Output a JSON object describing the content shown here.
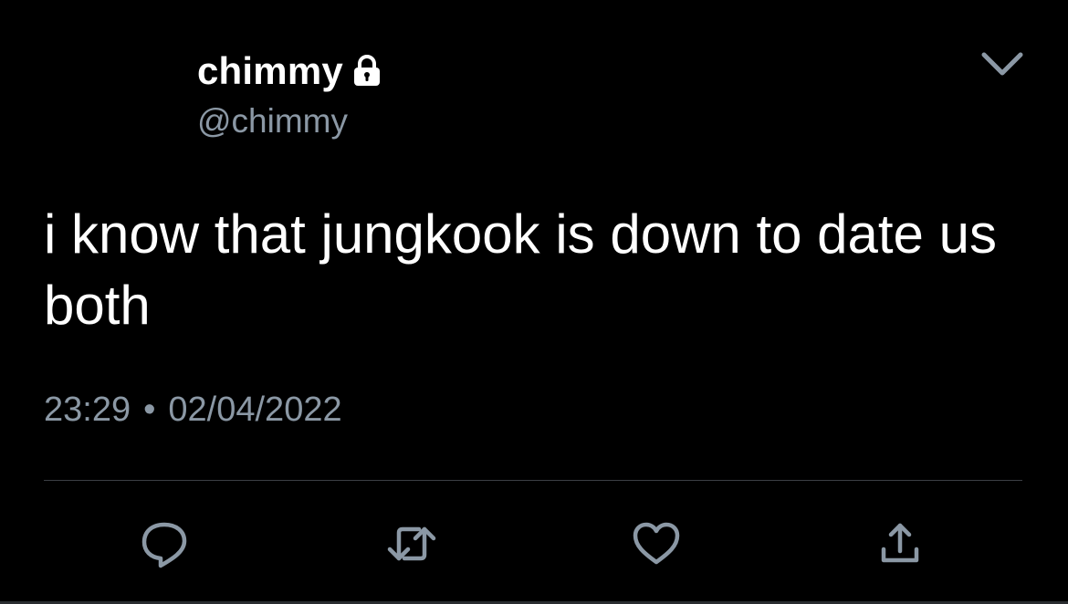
{
  "user": {
    "display_name": "chimmy",
    "handle": "@chimmy",
    "protected_icon": "lock-icon"
  },
  "tweet": {
    "text": "i know that jungkook is down to date us both",
    "time": "23:29",
    "separator": "•",
    "date": "02/04/2022"
  },
  "header": {
    "menu_icon": "chevron-down-icon"
  },
  "actions": [
    {
      "name": "reply",
      "icon": "reply-icon"
    },
    {
      "name": "retweet",
      "icon": "retweet-icon"
    },
    {
      "name": "like",
      "icon": "heart-icon"
    },
    {
      "name": "share",
      "icon": "share-icon"
    }
  ],
  "colors": {
    "background": "#000000",
    "text": "#ffffff",
    "secondary": "#8b98a5",
    "divider": "#3b3f44"
  }
}
